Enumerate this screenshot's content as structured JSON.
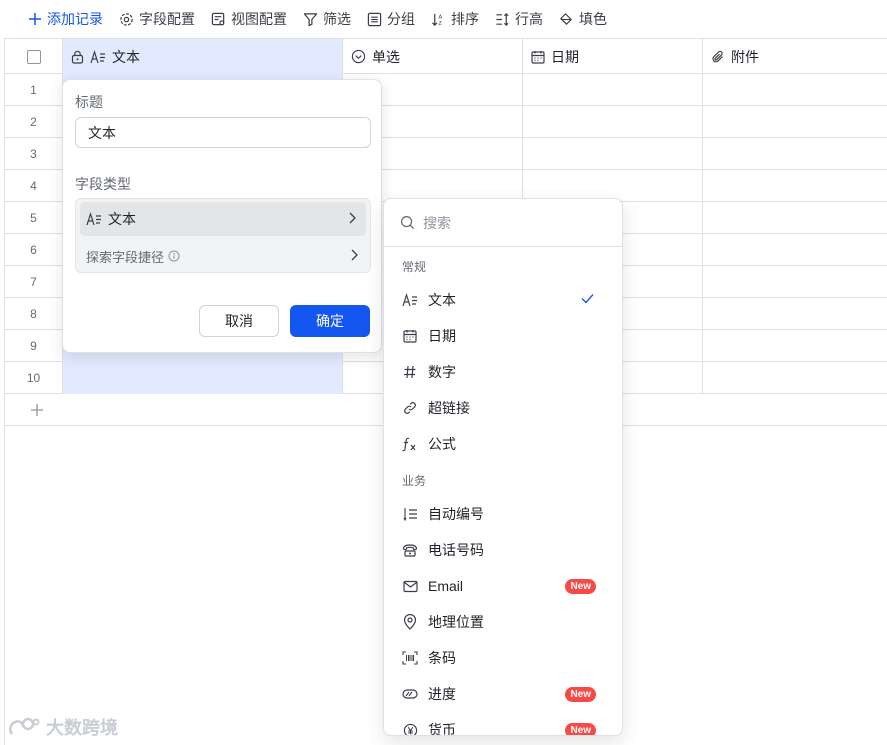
{
  "toolbar": {
    "add_record": "添加记录",
    "field_config": "字段配置",
    "view_config": "视图配置",
    "filter": "筛选",
    "group": "分组",
    "sort": "排序",
    "row_height": "行高",
    "fill_color": "填色"
  },
  "columns": [
    {
      "label": "文本",
      "icon": "text-icon",
      "locked": true
    },
    {
      "label": "单选",
      "icon": "single-select-icon"
    },
    {
      "label": "日期",
      "icon": "calendar-icon"
    },
    {
      "label": "附件",
      "icon": "paperclip-icon"
    }
  ],
  "rows": [
    "1",
    "2",
    "3",
    "4",
    "5",
    "6",
    "7",
    "8",
    "9",
    "10"
  ],
  "popover": {
    "title_label": "标题",
    "title_value": "文本",
    "type_label": "字段类型",
    "type_value": "文本",
    "explore_label": "探索字段捷径",
    "cancel": "取消",
    "confirm": "确定"
  },
  "dropdown": {
    "search_placeholder": "搜索",
    "groups": [
      {
        "label": "常规",
        "items": [
          {
            "label": "文本",
            "icon": "text-icon",
            "selected": true
          },
          {
            "label": "日期",
            "icon": "calendar-icon"
          },
          {
            "label": "数字",
            "icon": "hash-icon"
          },
          {
            "label": "超链接",
            "icon": "link-icon"
          },
          {
            "label": "公式",
            "icon": "formula-icon"
          }
        ]
      },
      {
        "label": "业务",
        "items": [
          {
            "label": "自动编号",
            "icon": "auto-number-icon"
          },
          {
            "label": "电话号码",
            "icon": "phone-icon"
          },
          {
            "label": "Email",
            "icon": "mail-icon",
            "badge": "New"
          },
          {
            "label": "地理位置",
            "icon": "location-icon"
          },
          {
            "label": "条码",
            "icon": "barcode-icon"
          },
          {
            "label": "进度",
            "icon": "progress-icon",
            "badge": "New"
          },
          {
            "label": "货币",
            "icon": "currency-icon",
            "badge": "New"
          }
        ]
      }
    ]
  },
  "watermark": "大数跨境",
  "colors": {
    "accent": "#1456f0",
    "selected_column": "#e1eaff",
    "badge": "#f54a45"
  }
}
